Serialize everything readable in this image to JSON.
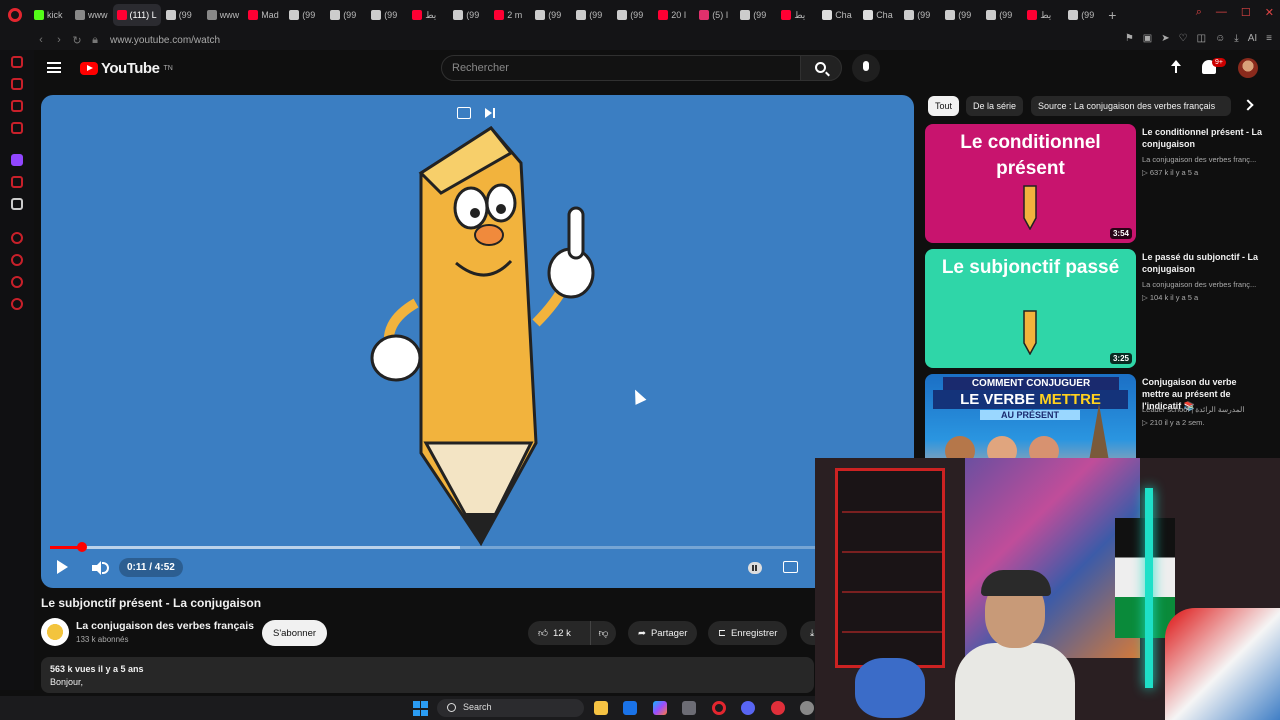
{
  "browser": {
    "tabs": [
      {
        "label": "kick",
        "color": "#53fc18"
      },
      {
        "label": "www",
        "color": "#888888"
      },
      {
        "label": "(111) L",
        "color": "#ff0033",
        "active": true
      },
      {
        "label": "(99",
        "color": "#cccccc"
      },
      {
        "label": "www",
        "color": "#888888"
      },
      {
        "label": "Mad",
        "color": "#ff0033"
      },
      {
        "label": "(99",
        "color": "#cccccc"
      },
      {
        "label": "(99",
        "color": "#cccccc"
      },
      {
        "label": "(99",
        "color": "#cccccc"
      },
      {
        "label": "يط",
        "color": "#ff0033"
      },
      {
        "label": "(99",
        "color": "#cccccc"
      },
      {
        "label": "2 m",
        "color": "#ff0033"
      },
      {
        "label": "(99",
        "color": "#cccccc"
      },
      {
        "label": "(99",
        "color": "#cccccc"
      },
      {
        "label": "(99",
        "color": "#cccccc"
      },
      {
        "label": "20 I",
        "color": "#ff0033"
      },
      {
        "label": "(5) I",
        "color": "#e1306c"
      },
      {
        "label": "(99",
        "color": "#cccccc"
      },
      {
        "label": "يط",
        "color": "#ff0033"
      },
      {
        "label": "Cha",
        "color": "#dddddd"
      },
      {
        "label": "Cha",
        "color": "#dddddd"
      },
      {
        "label": "(99",
        "color": "#cccccc"
      },
      {
        "label": "(99",
        "color": "#cccccc"
      },
      {
        "label": "(99",
        "color": "#cccccc"
      },
      {
        "label": "يط",
        "color": "#ff0033"
      },
      {
        "label": "(99",
        "color": "#cccccc"
      }
    ],
    "new_tab": "+",
    "url": "www.youtube.com/watch",
    "addr_ai": "AI"
  },
  "youtube": {
    "logo_text": "YouTube",
    "logo_region": "TN",
    "search_placeholder": "Rechercher",
    "notifications_badge": "9+"
  },
  "player": {
    "current_time": "0:11",
    "duration": "4:52",
    "time_display": "0:11 / 4:52",
    "played_fraction": 0.038,
    "buffered_fraction": 0.48
  },
  "video": {
    "title": "Le subjonctif présent - La conjugaison",
    "channel": "La conjugaison des verbes français",
    "subscribers": "133 k abonnés",
    "subscribe_label": "S'abonner",
    "likes": "12 k",
    "share_label": "Partager",
    "save_label": "Enregistrer",
    "views_meta": "563 k vues  il y a 5 ans",
    "description_start": "Bonjour,"
  },
  "chips": [
    {
      "label": "Tout",
      "active": true
    },
    {
      "label": "De la série",
      "active": false
    },
    {
      "label": "Source : La conjugaison des verbes français",
      "active": false
    }
  ],
  "recommendations": [
    {
      "thumb_text": "Le conditionnel présent",
      "thumb_color": "#c8146e",
      "duration": "3:54",
      "title": "Le conditionnel présent - La conjugaison",
      "channel": "La conjugaison des verbes franç...",
      "meta": "▷ 637 k  il y a 5 a"
    },
    {
      "thumb_text": "Le subjonctif passé",
      "thumb_color": "#2fd6a8",
      "duration": "3:25",
      "title": "Le passé du subjonctif - La conjugaison",
      "channel": "La conjugaison des verbes franç...",
      "meta": "▷ 104 k  il y a 5 a"
    },
    {
      "thumb_line1": "COMMENT CONJUGUER",
      "thumb_line2a": "LE VERBE ",
      "thumb_line2b": "METTRE",
      "thumb_line3": "AU PRÉSENT",
      "title": "Conjugaison du verbe mettre au présent de l'indicatif 📚",
      "channel": "Leader school | المدرسة الرائدة",
      "meta": "▷ 210  il y a 2 sem."
    }
  ],
  "taskbar": {
    "search_label": "Search"
  }
}
